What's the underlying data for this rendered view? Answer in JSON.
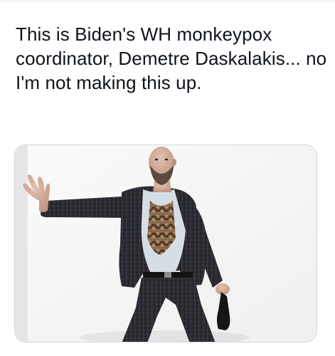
{
  "tweet": {
    "text": "This is Biden's WH monkeypox coordinator, Demetre Daskalakis... no I'm not making this up."
  },
  "media": {
    "description_icon": "photo-icon",
    "colors": {
      "wall": "#f8f8f8",
      "suit": "#2a2a30",
      "shirt": "#d7dde5",
      "skin": "#c8a28e",
      "beard": "#5b4a3d",
      "border": "#cfd9de"
    }
  }
}
